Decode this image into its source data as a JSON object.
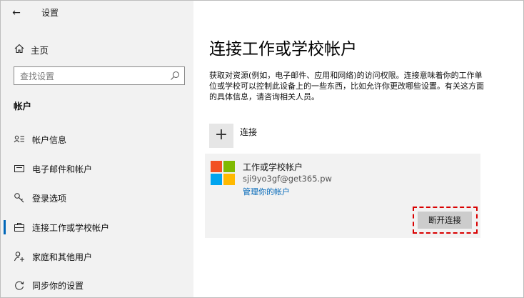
{
  "header": {
    "back_glyph": "←",
    "app_title": "设置"
  },
  "sidebar": {
    "home_label": "主页",
    "search_placeholder": "查找设置",
    "section_heading": "帐户",
    "items": [
      {
        "label": "帐户信息",
        "icon": "account-info-icon"
      },
      {
        "label": "电子邮件和帐户",
        "icon": "mail-icon"
      },
      {
        "label": "登录选项",
        "icon": "key-icon"
      },
      {
        "label": "连接工作或学校帐户",
        "icon": "briefcase-icon",
        "active": true
      },
      {
        "label": "家庭和其他用户",
        "icon": "person-add-icon"
      },
      {
        "label": "同步你的设置",
        "icon": "sync-icon"
      }
    ]
  },
  "main": {
    "title": "连接工作或学校帐户",
    "description": "获取对资源(例如，电子邮件、应用和网络)的访问权限。连接意味着你的工作单位或学校可以控制此设备上的一些东西，比如允许你更改哪些设置。有关这方面的具体信息，请咨询相关人员。",
    "connect": {
      "plus_glyph": "+",
      "label": "连接"
    },
    "account": {
      "title": "工作或学校帐户",
      "email": "sji9yo3gf@get365.pw",
      "manage_link": "管理你的帐户",
      "disconnect_label": "断开连接"
    }
  },
  "colors": {
    "accent": "#0067b8",
    "highlight_border": "#d90000",
    "ms_red": "#f25022",
    "ms_green": "#7fba00",
    "ms_blue": "#00a4ef",
    "ms_yellow": "#ffb900"
  }
}
